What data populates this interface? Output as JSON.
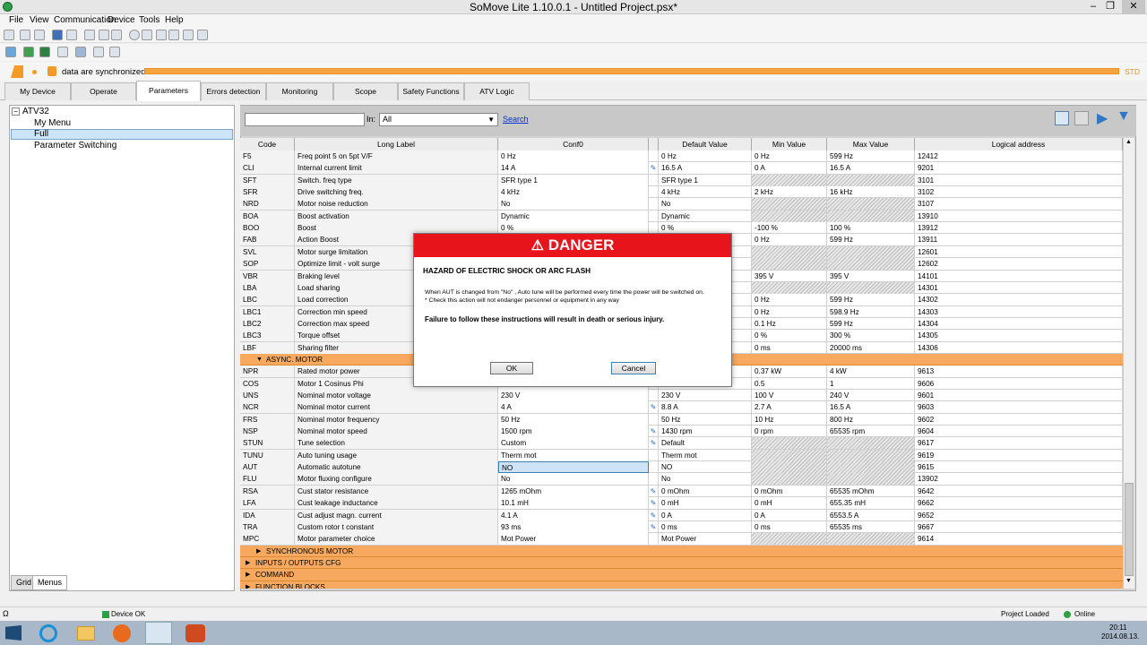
{
  "window": {
    "title": "SoMove Lite 1.10.0.1 - Untitled Project.psx*",
    "buttons": [
      "–",
      "❐",
      "✕"
    ]
  },
  "menu": [
    "File",
    "View",
    "Communication",
    "Device",
    "Tools",
    "Help"
  ],
  "sync": {
    "text": "data are synchronized",
    "std": "STD"
  },
  "tabs": [
    "My Device",
    "Operate",
    "Parameters",
    "Errors detection",
    "Monitoring",
    "Scope",
    "Safety Functions",
    "ATV Logic"
  ],
  "tree": {
    "root": "ATV32",
    "items": [
      "My Menu",
      "Full",
      "Parameter Switching"
    ]
  },
  "left_tabs": [
    "Grid",
    "Menus"
  ],
  "search": {
    "value": "",
    "in_label": "In:",
    "in_value": "All",
    "search_link": "Search"
  },
  "columns": [
    "Code",
    "Long Label",
    "Conf0",
    "Default Value",
    "Min Value",
    "Max Value",
    "Logical address"
  ],
  "rows": [
    {
      "code": "F5",
      "label": "Freq point 5 on 5pt V/F",
      "conf": "0 Hz",
      "def": "0 Hz",
      "min": "0 Hz",
      "max": "599 Hz",
      "addr": "12412"
    },
    {
      "code": "CLI",
      "label": "Internal current limit",
      "conf": "14 A",
      "def": "16.5 A",
      "min": "0 A",
      "max": "16.5 A",
      "addr": "9201",
      "pen": true
    },
    {
      "code": "SFT",
      "label": "Switch. freq type",
      "conf": "SFR type 1",
      "def": "SFR type 1",
      "min": "",
      "max": "",
      "addr": "3101",
      "hatch": true
    },
    {
      "code": "SFR",
      "label": "Drive switching freq.",
      "conf": "4 kHz",
      "def": "4 kHz",
      "min": "2 kHz",
      "max": "16 kHz",
      "addr": "3102"
    },
    {
      "code": "NRD",
      "label": "Motor noise reduction",
      "conf": "No",
      "def": "No",
      "min": "",
      "max": "",
      "addr": "3107",
      "hatch": true
    },
    {
      "code": "BOA",
      "label": "Boost activation",
      "conf": "Dynamic",
      "def": "Dynamic",
      "min": "",
      "max": "",
      "addr": "13910",
      "hatch": true
    },
    {
      "code": "BOO",
      "label": "Boost",
      "conf": "0 %",
      "def": "0 %",
      "min": "-100 %",
      "max": "100 %",
      "addr": "13912"
    },
    {
      "code": "FAB",
      "label": "Action Boost",
      "conf": "",
      "def": "",
      "min": "0 Hz",
      "max": "599 Hz",
      "addr": "13911"
    },
    {
      "code": "SVL",
      "label": "Motor surge limitation",
      "conf": "",
      "def": "",
      "min": "",
      "max": "",
      "addr": "12601",
      "hatch": true
    },
    {
      "code": "SOP",
      "label": "Optimize limit - volt surge",
      "conf": "",
      "def": "",
      "min": "",
      "max": "",
      "addr": "12602",
      "hatch": true
    },
    {
      "code": "VBR",
      "label": "Braking level",
      "conf": "",
      "def": "",
      "min": "395 V",
      "max": "395 V",
      "addr": "14101"
    },
    {
      "code": "LBA",
      "label": "Load sharing",
      "conf": "",
      "def": "",
      "min": "",
      "max": "",
      "addr": "14301",
      "hatch": true
    },
    {
      "code": "LBC",
      "label": "Load correction",
      "conf": "",
      "def": "",
      "min": "0 Hz",
      "max": "599 Hz",
      "addr": "14302"
    },
    {
      "code": "LBC1",
      "label": "Correction min speed",
      "conf": "",
      "def": "",
      "min": "0 Hz",
      "max": "598.9 Hz",
      "addr": "14303"
    },
    {
      "code": "LBC2",
      "label": "Correction max speed",
      "conf": "",
      "def": "",
      "min": "0.1 Hz",
      "max": "599 Hz",
      "addr": "14304"
    },
    {
      "code": "LBC3",
      "label": "Torque offset",
      "conf": "",
      "def": "",
      "min": "0 %",
      "max": "300 %",
      "addr": "14305"
    },
    {
      "code": "LBF",
      "label": "Sharing filter",
      "conf": "",
      "def": "",
      "min": "0 ms",
      "max": "20000 ms",
      "addr": "14306"
    },
    {
      "group": "ASYNC. MOTOR",
      "open": true
    },
    {
      "code": "NPR",
      "label": "Rated motor power",
      "conf": "",
      "def": "",
      "min": "0.37 kW",
      "max": "4 kW",
      "addr": "9613"
    },
    {
      "code": "COS",
      "label": "Motor 1 Cosinus Phi",
      "conf": "",
      "def": "",
      "min": "0.5",
      "max": "1",
      "addr": "9606"
    },
    {
      "code": "UNS",
      "label": "Nominal motor voltage",
      "conf": "230 V",
      "def": "230 V",
      "min": "100 V",
      "max": "240 V",
      "addr": "9601"
    },
    {
      "code": "NCR",
      "label": "Nominal motor current",
      "conf": "4 A",
      "def": "8.8 A",
      "min": "2.7 A",
      "max": "16.5 A",
      "addr": "9603",
      "pen": true
    },
    {
      "code": "FRS",
      "label": "Nominal motor frequency",
      "conf": "50 Hz",
      "def": "50 Hz",
      "min": "10 Hz",
      "max": "800 Hz",
      "addr": "9602"
    },
    {
      "code": "NSP",
      "label": "Nominal motor speed",
      "conf": "1500 rpm",
      "def": "1430 rpm",
      "min": "0 rpm",
      "max": "65535 rpm",
      "addr": "9604",
      "pen": true
    },
    {
      "code": "STUN",
      "label": "Tune selection",
      "conf": "Custom",
      "def": "Default",
      "min": "",
      "max": "",
      "addr": "9617",
      "hatch": true,
      "pen": true
    },
    {
      "code": "TUNU",
      "label": "Auto tuning usage",
      "conf": "Therm mot",
      "def": "Therm mot",
      "min": "",
      "max": "",
      "addr": "9619",
      "hatch": true
    },
    {
      "code": "AUT",
      "label": "Automatic autotune",
      "conf": "NO",
      "def": "NO",
      "min": "",
      "max": "",
      "addr": "9615",
      "hatch": true,
      "sel": true
    },
    {
      "code": "FLU",
      "label": "Motor fluxing configure",
      "conf": "No",
      "def": "No",
      "min": "",
      "max": "",
      "addr": "13902",
      "hatch": true
    },
    {
      "code": "RSA",
      "label": "Cust stator resistance",
      "conf": "1265 mOhm",
      "def": "0 mOhm",
      "min": "0 mOhm",
      "max": "65535 mOhm",
      "addr": "9642",
      "pen": true
    },
    {
      "code": "LFA",
      "label": "Cust leakage inductance",
      "conf": "10.1 mH",
      "def": "0 mH",
      "min": "0 mH",
      "max": "655.35 mH",
      "addr": "9662",
      "pen": true
    },
    {
      "code": "IDA",
      "label": "Cust adjust magn. current",
      "conf": "4.1 A",
      "def": "0 A",
      "min": "0 A",
      "max": "6553.5 A",
      "addr": "9652",
      "pen": true
    },
    {
      "code": "TRA",
      "label": "Custom rotor t constant",
      "conf": "93 ms",
      "def": "0 ms",
      "min": "0 ms",
      "max": "65535 ms",
      "addr": "9667",
      "pen": true
    },
    {
      "code": "MPC",
      "label": "Motor parameter choice",
      "conf": "Mot Power",
      "def": "Mot Power",
      "min": "",
      "max": "",
      "addr": "9614",
      "hatch": true
    },
    {
      "group": "SYNCHRONOUS MOTOR",
      "open": false
    },
    {
      "group": "INPUTS / OUTPUTS CFG",
      "open": false,
      "top": true
    },
    {
      "group": "COMMAND",
      "open": false,
      "top": true
    },
    {
      "group": "FUNCTION BLOCKS",
      "open": false,
      "top": true
    }
  ],
  "dialog": {
    "title": "DANGER",
    "hazard": "HAZARD OF ELECTRIC SHOCK OR ARC FLASH",
    "line1": "When AUT is changed from \"No\" , Auto tune will be performed every time the power will be switched on.",
    "line2": "* Check this action will not endanger personnel or equipment in any way",
    "warning": "Failure to follow these instructions will result in death or serious injury.",
    "ok": "OK",
    "cancel": "Cancel"
  },
  "status": {
    "device": "Device OK",
    "project": "Project Loaded",
    "online": "Online",
    "left": "Ω"
  },
  "taskbar": {
    "time": "20:11",
    "date": "2014.08.13."
  },
  "colors": {
    "orange": "#f7a95f",
    "danger": "#e8141b",
    "selection": "#cfe3f7"
  }
}
